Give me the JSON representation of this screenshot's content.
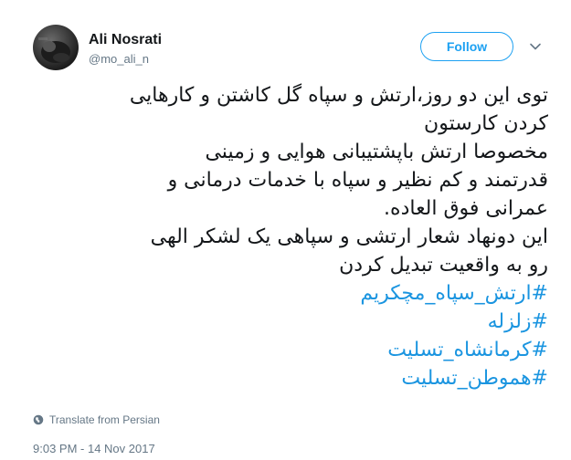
{
  "author": {
    "name": "Ali Nosrati",
    "handle": "@mo_ali_n"
  },
  "follow_label": "Follow",
  "tweet": {
    "lines": [
      "توی این دو روز،ارتش و سپاه گل کاشتن و کارهایی",
      "کردن کارستون",
      "مخصوصا ارتش باپشتیبانی هوایی و زمینی",
      "قدرتمند و کم نظیر و سپاه با خدمات درمانی و",
      "عمرانی فوق العاده.",
      "این دونهاد شعار ارتشی و سپاهی یک لشکر الهی",
      "رو به واقعیت تبدیل کردن"
    ],
    "hashtags": [
      "#ارتش_سپاه_مچکریم",
      "#زلزله",
      "#کرمانشاه_تسلیت",
      "#هموطن_تسلیت"
    ]
  },
  "translate_label": "Translate from Persian",
  "timestamp": "9:03 PM - 14 Nov 2017",
  "colors": {
    "accent": "#1da1f2",
    "hashtag": "#1b95e0",
    "muted": "#657786"
  },
  "icons": {
    "avatar": "profile-photo",
    "menu": "chevron-down-icon",
    "translate": "globe-icon"
  }
}
